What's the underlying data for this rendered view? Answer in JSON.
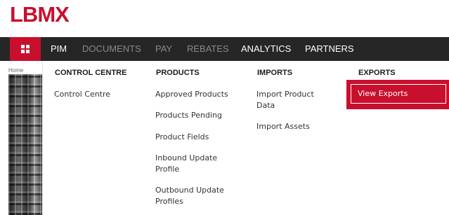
{
  "brand": {
    "logo_text": "LBMX",
    "accent": "#c8102e"
  },
  "navbar": {
    "menu_icon": "grid-icon",
    "items": [
      {
        "label": "PIM",
        "active": true
      },
      {
        "label": "DOCUMENTS",
        "active": false
      },
      {
        "label": "PAY",
        "active": false
      },
      {
        "label": "REBATES",
        "active": false
      },
      {
        "label": "ANALYTICS",
        "active": true
      },
      {
        "label": "PARTNERS",
        "active": true
      }
    ]
  },
  "page": {
    "breadcrumb": "Home"
  },
  "mega_menu": {
    "columns": [
      {
        "heading": "CONTROL CENTRE",
        "links": [
          "Control Centre"
        ]
      },
      {
        "heading": "PRODUCTS",
        "links": [
          "Approved Products",
          "Products Pending",
          "Product Fields",
          "Inbound Update Profile",
          "Outbound Update Profiles"
        ]
      },
      {
        "heading": "IMPORTS",
        "links": [
          "Import Product Data",
          "Import Assets"
        ]
      },
      {
        "heading": "EXPORTS",
        "links": [
          "View Exports"
        ]
      }
    ]
  }
}
